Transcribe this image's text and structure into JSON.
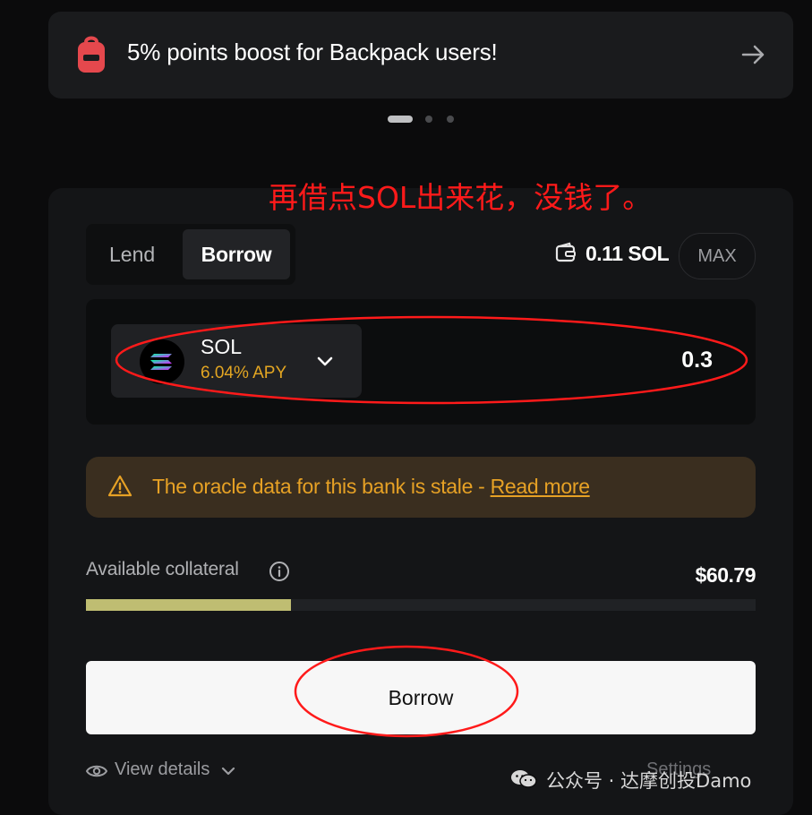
{
  "banner": {
    "text": "5% points boost for Backpack users!",
    "icon": "backpack-icon",
    "arrow_icon": "arrow-right-icon"
  },
  "carousel": {
    "count": 3,
    "active": 0
  },
  "annotation": {
    "text": "再借点SOL出来花，没钱了。",
    "color": "#ff1a1a"
  },
  "mode_toggle": {
    "lend_label": "Lend",
    "borrow_label": "Borrow",
    "active": "borrow"
  },
  "wallet": {
    "icon": "wallet-icon",
    "balance": "0.11 SOL",
    "max_label": "MAX"
  },
  "asset": {
    "symbol": "SOL",
    "apy": "6.04% APY",
    "logo": "solana-logo",
    "chevron": "chevron-down-icon",
    "amount": "0.3"
  },
  "warning": {
    "icon": "warning-triangle-icon",
    "text": "The oracle data for this bank is stale - ",
    "link": "Read more"
  },
  "collateral": {
    "label": "Available collateral",
    "info_icon": "info-icon",
    "value": "$60.79",
    "fill_fraction": 0.306
  },
  "borrow_button": {
    "label": "Borrow"
  },
  "footer": {
    "view_details": "View details",
    "eye_icon": "eye-icon",
    "settings": "Settings"
  },
  "watermark": {
    "text": "公众号 · 达摩创投Damo",
    "icon": "wechat-icon"
  },
  "colors": {
    "accent_apy": "#e3a622",
    "warning_bg": "#3a2e1f",
    "progress_fill": "#bfbd72",
    "annotation_red": "#ff1a1a"
  }
}
